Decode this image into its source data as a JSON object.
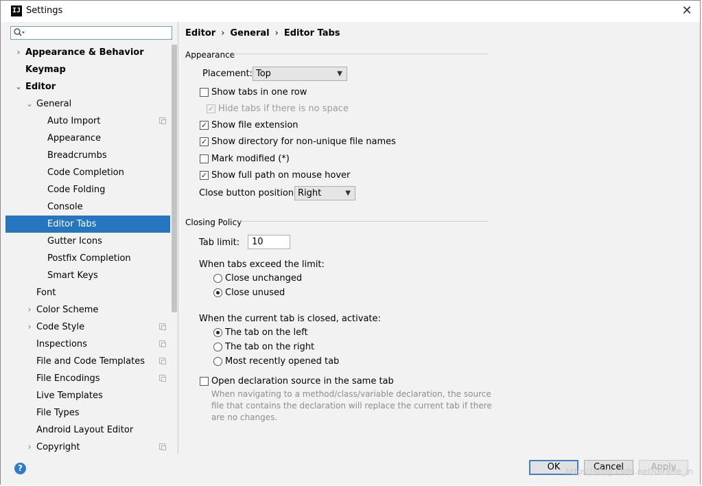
{
  "window": {
    "title": "Settings",
    "app_icon": "IJ",
    "close": "✕"
  },
  "search": {
    "value": "",
    "placeholder": ""
  },
  "tree": [
    {
      "label": "Appearance & Behavior",
      "level": 0,
      "bold": true,
      "arrow": "›",
      "copy": false,
      "selected": false
    },
    {
      "label": "Keymap",
      "level": 0,
      "bold": true,
      "arrow": "",
      "copy": false,
      "selected": false
    },
    {
      "label": "Editor",
      "level": 0,
      "bold": true,
      "arrow": "⌄",
      "copy": false,
      "selected": false
    },
    {
      "label": "General",
      "level": 1,
      "bold": false,
      "arrow": "⌄",
      "copy": false,
      "selected": false
    },
    {
      "label": "Auto Import",
      "level": 2,
      "bold": false,
      "arrow": "",
      "copy": true,
      "selected": false
    },
    {
      "label": "Appearance",
      "level": 2,
      "bold": false,
      "arrow": "",
      "copy": false,
      "selected": false
    },
    {
      "label": "Breadcrumbs",
      "level": 2,
      "bold": false,
      "arrow": "",
      "copy": false,
      "selected": false
    },
    {
      "label": "Code Completion",
      "level": 2,
      "bold": false,
      "arrow": "",
      "copy": false,
      "selected": false
    },
    {
      "label": "Code Folding",
      "level": 2,
      "bold": false,
      "arrow": "",
      "copy": false,
      "selected": false
    },
    {
      "label": "Console",
      "level": 2,
      "bold": false,
      "arrow": "",
      "copy": false,
      "selected": false
    },
    {
      "label": "Editor Tabs",
      "level": 2,
      "bold": false,
      "arrow": "",
      "copy": false,
      "selected": true
    },
    {
      "label": "Gutter Icons",
      "level": 2,
      "bold": false,
      "arrow": "",
      "copy": false,
      "selected": false
    },
    {
      "label": "Postfix Completion",
      "level": 2,
      "bold": false,
      "arrow": "",
      "copy": false,
      "selected": false
    },
    {
      "label": "Smart Keys",
      "level": 2,
      "bold": false,
      "arrow": "",
      "copy": false,
      "selected": false
    },
    {
      "label": "Font",
      "level": 1,
      "bold": false,
      "arrow": "",
      "copy": false,
      "selected": false
    },
    {
      "label": "Color Scheme",
      "level": 1,
      "bold": false,
      "arrow": "›",
      "copy": false,
      "selected": false
    },
    {
      "label": "Code Style",
      "level": 1,
      "bold": false,
      "arrow": "›",
      "copy": true,
      "selected": false
    },
    {
      "label": "Inspections",
      "level": 1,
      "bold": false,
      "arrow": "",
      "copy": true,
      "selected": false
    },
    {
      "label": "File and Code Templates",
      "level": 1,
      "bold": false,
      "arrow": "",
      "copy": true,
      "selected": false
    },
    {
      "label": "File Encodings",
      "level": 1,
      "bold": false,
      "arrow": "",
      "copy": true,
      "selected": false
    },
    {
      "label": "Live Templates",
      "level": 1,
      "bold": false,
      "arrow": "",
      "copy": false,
      "selected": false
    },
    {
      "label": "File Types",
      "level": 1,
      "bold": false,
      "arrow": "",
      "copy": false,
      "selected": false
    },
    {
      "label": "Android Layout Editor",
      "level": 1,
      "bold": false,
      "arrow": "",
      "copy": false,
      "selected": false
    },
    {
      "label": "Copyright",
      "level": 1,
      "bold": false,
      "arrow": "›",
      "copy": true,
      "selected": false
    }
  ],
  "breadcrumb": {
    "items": [
      "Editor",
      "General",
      "Editor Tabs"
    ],
    "separator": "›"
  },
  "appearance": {
    "title": "Appearance",
    "placement_label": "Placement:",
    "placement_value": "Top",
    "show_tabs_one_row": {
      "label": "Show tabs in one row",
      "checked": false
    },
    "hide_tabs_no_space": {
      "label": "Hide tabs if there is no space",
      "checked": true,
      "disabled": true
    },
    "show_file_extension": {
      "label": "Show file extension",
      "checked": true
    },
    "show_directory": {
      "label": "Show directory for non-unique file names",
      "checked": true
    },
    "mark_modified": {
      "label": "Mark modified (*)",
      "checked": false
    },
    "show_full_path": {
      "label": "Show full path on mouse hover",
      "checked": true
    },
    "close_button_label": "Close button position:",
    "close_button_value": "Right"
  },
  "closing_policy": {
    "title": "Closing Policy",
    "tab_limit_label": "Tab limit:",
    "tab_limit_value": "10",
    "exceed_label": "When tabs exceed the limit:",
    "close_unchanged": {
      "label": "Close unchanged",
      "checked": false
    },
    "close_unused": {
      "label": "Close unused",
      "checked": true
    },
    "activate_label": "When the current tab is closed, activate:",
    "tab_left": {
      "label": "The tab on the left",
      "checked": true
    },
    "tab_right": {
      "label": "The tab on the right",
      "checked": false
    },
    "most_recent": {
      "label": "Most recently opened tab",
      "checked": false
    },
    "open_declaration": {
      "label": "Open declaration source in the same tab",
      "checked": false
    },
    "open_declaration_desc": "When navigating to a method/class/variable declaration, the source file that contains the declaration will replace the current tab if there are no changes."
  },
  "buttons": {
    "ok": "OK",
    "cancel": "Cancel",
    "apply": "Apply",
    "help": "?"
  },
  "watermark": "https://blog.csdn.net/Giraffe_in",
  "colors": {
    "selection": "#2675bf",
    "accent": "#3c7fc6"
  }
}
